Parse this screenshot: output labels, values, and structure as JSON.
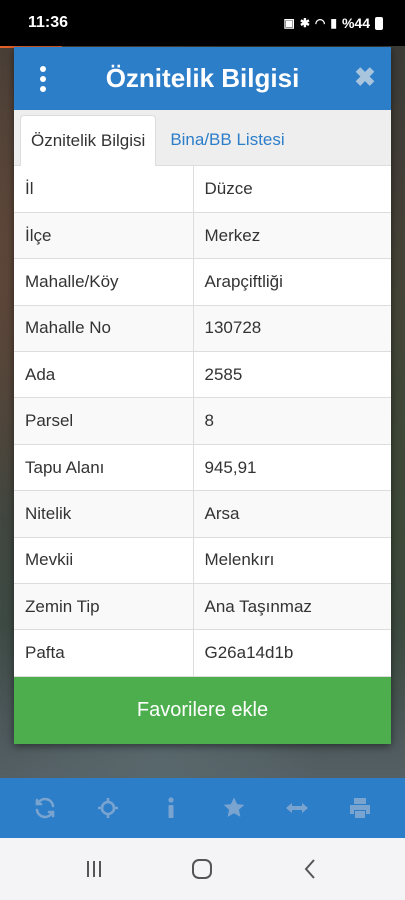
{
  "status_bar": {
    "time": "11:36",
    "battery": "%44"
  },
  "dialog": {
    "title": "Öznitelik Bilgisi",
    "tabs": [
      {
        "label": "Öznitelik Bilgisi",
        "active": true
      },
      {
        "label": "Bina/BB Listesi",
        "active": false
      }
    ],
    "rows": [
      {
        "key": "İl",
        "value": "Düzce"
      },
      {
        "key": "İlçe",
        "value": "Merkez"
      },
      {
        "key": "Mahalle/Köy",
        "value": "Arapçiftliği"
      },
      {
        "key": "Mahalle No",
        "value": "130728"
      },
      {
        "key": "Ada",
        "value": "2585"
      },
      {
        "key": "Parsel",
        "value": "8"
      },
      {
        "key": "Tapu Alanı",
        "value": "945,91"
      },
      {
        "key": "Nitelik",
        "value": "Arsa"
      },
      {
        "key": "Mevkii",
        "value": "Melenkırı"
      },
      {
        "key": "Zemin Tip",
        "value": "Ana Taşınmaz"
      },
      {
        "key": "Pafta",
        "value": "G26a14d1b"
      }
    ],
    "favorite_button": "Favorilere ekle"
  },
  "toolbar": {
    "icons": [
      "refresh-icon",
      "crosshair-icon",
      "info-icon",
      "star-icon",
      "measure-icon",
      "print-icon"
    ]
  },
  "navbar": {
    "icons": [
      "recents-icon",
      "home-icon",
      "back-icon"
    ]
  },
  "colors": {
    "primary_blue": "#2d7ec9",
    "success_green": "#4cae4c"
  }
}
